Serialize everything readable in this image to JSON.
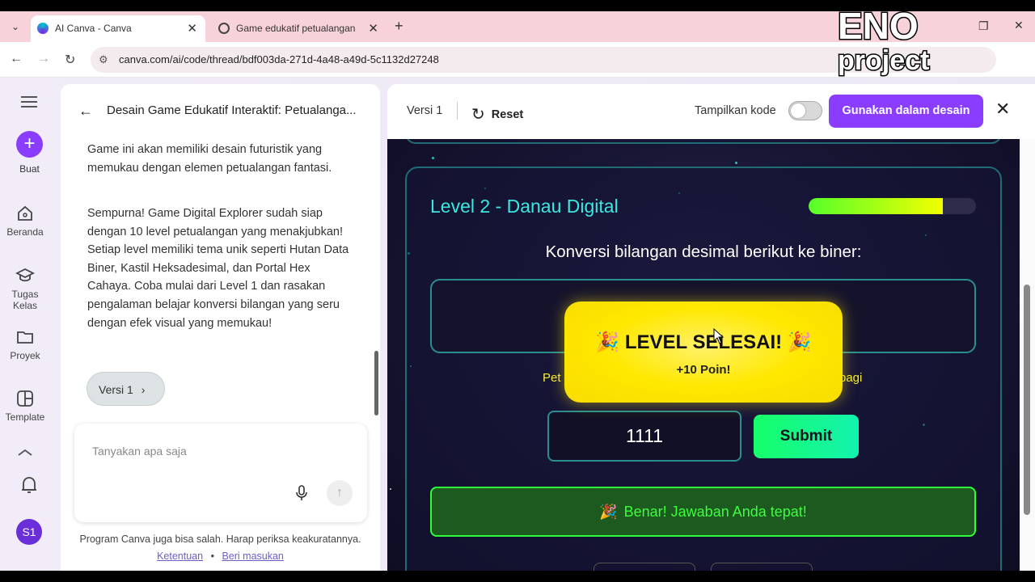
{
  "browser": {
    "tabs": [
      {
        "title": "AI Canva - Canva",
        "active": true
      },
      {
        "title": "Game edukatif petualangan",
        "active": false
      }
    ],
    "url": "canva.com/ai/code/thread/bdf003da-271d-4a48-a49d-5c1132d27248"
  },
  "watermark": {
    "line1": "ENO",
    "line2": "project"
  },
  "rail": {
    "create_label": "Buat",
    "items": [
      {
        "label": "Beranda",
        "icon": "home-icon"
      },
      {
        "label": "Tugas Kelas",
        "icon": "graduation-cap-icon"
      },
      {
        "label": "Proyek",
        "icon": "folder-icon"
      },
      {
        "label": "Template",
        "icon": "template-icon"
      }
    ],
    "avatar": "S1"
  },
  "chat": {
    "title": "Desain Game Edukatif Interaktif: Petualanga...",
    "message_partial": "Game ini akan memiliki desain futuristik yang memukau dengan elemen petualangan fantasi.",
    "message": "Sempurna! Game Digital Explorer sudah siap dengan 10 level petualangan yang menakjubkan! Setiap level memiliki tema unik seperti Hutan Data Biner, Kastil Heksadesimal, dan Portal Hex Cahaya. Coba mulai dari Level 1 dan rasakan pengalaman belajar konversi bilangan yang seru dengan efek visual yang memukau!",
    "version_pill": "Versi 1",
    "input_placeholder": "Tanyakan apa saja",
    "disclaimer": "Program Canva juga bisa salah. Harap periksa keakuratannya.",
    "link_terms": "Ketentuan",
    "link_separator": "•",
    "link_feedback": "Beri masukan"
  },
  "preview": {
    "version": "Versi 1",
    "reset": "Reset",
    "show_code": "Tampilkan kode",
    "use_button": "Gunakan dalam desain"
  },
  "game": {
    "level_title": "Level 2 - Danau Digital",
    "progress_fraction": 0.8,
    "question": "Konversi bilangan desimal berikut ke biner:",
    "hint_left": "Pet",
    "hint_right": "bagi",
    "popup_title": "LEVEL SELESAI!",
    "popup_points": "+10 Poin!",
    "input_value": "1111",
    "submit": "Submit",
    "feedback": "Benar! Jawaban Anda tepat!"
  }
}
